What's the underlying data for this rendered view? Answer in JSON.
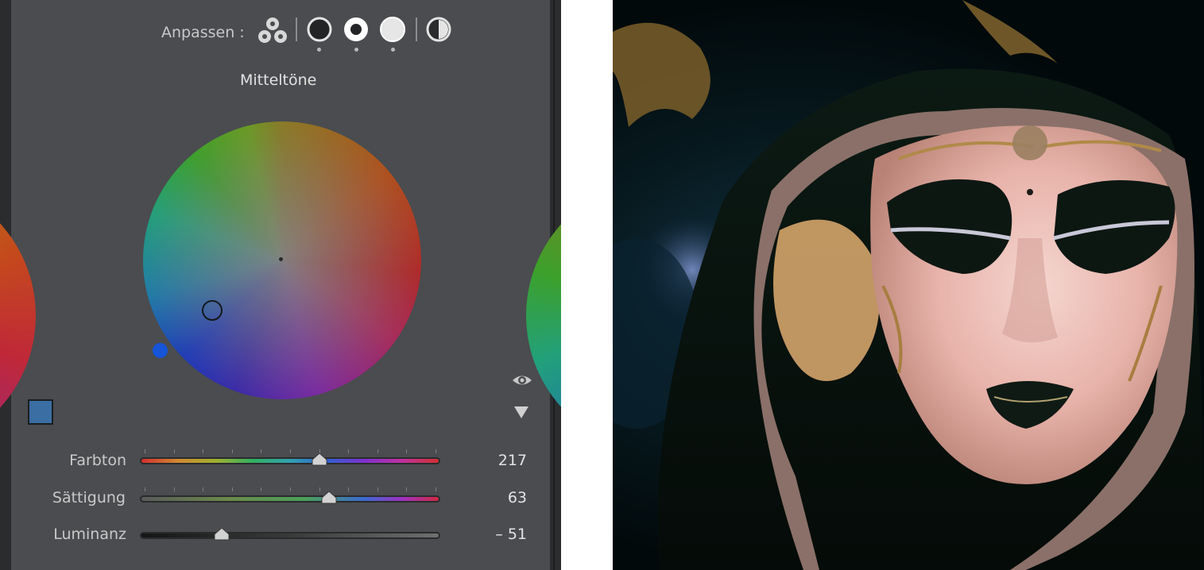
{
  "header": {
    "adjust_label": "Anpassen :",
    "mode_title": "Mitteltöne",
    "modes": [
      "three-way-icon",
      "shadows-icon",
      "midtones-icon",
      "highlights-icon",
      "global-icon"
    ]
  },
  "wheel": {
    "handle_hue": 217,
    "handle_saturation": 63,
    "luminance_indicator_color": "#1655d8"
  },
  "swatch": {
    "color": "#3b6ea3"
  },
  "sliders": {
    "hue": {
      "label": "Farbton",
      "value": "217",
      "fraction": 0.6
    },
    "saturation": {
      "label": "Sättigung",
      "value": "63",
      "fraction": 0.63
    },
    "luminance": {
      "label": "Luminanz",
      "value": "– 51",
      "fraction": 0.27
    }
  },
  "photo": {
    "subject": "venetian-mask-photo"
  }
}
